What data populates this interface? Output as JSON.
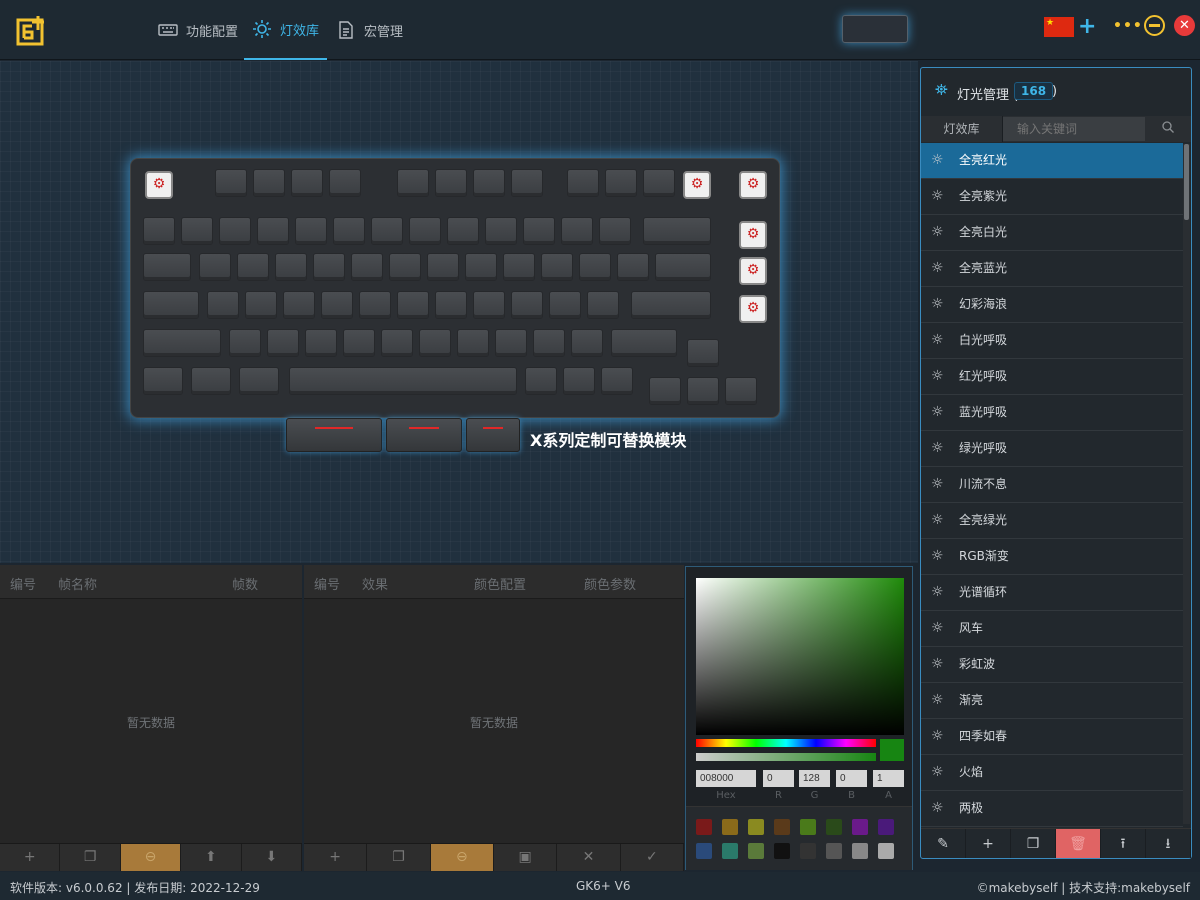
{
  "nav": {
    "tabs": [
      {
        "label": "功能配置"
      },
      {
        "label": "灯效库"
      },
      {
        "label": "宏管理"
      }
    ],
    "active": "灯效库"
  },
  "keyboard": {
    "spare_label": "X系列定制可替换模块"
  },
  "frames_panel": {
    "headers": [
      "编号",
      "帧名称",
      "帧数"
    ],
    "empty": "暂无数据"
  },
  "effects_panel": {
    "headers": [
      "编号",
      "效果",
      "颜色配置",
      "颜色参数"
    ],
    "empty": "暂无数据"
  },
  "color_picker": {
    "hex": "008000",
    "r": "0",
    "g": "128",
    "b": "0",
    "a": "1",
    "labels": [
      "Hex",
      "R",
      "G",
      "B",
      "A"
    ],
    "current_color": "#178512",
    "swatches": [
      "#7a1a1a",
      "#8a6a1a",
      "#8a8a20",
      "#5a3a1a",
      "#4a7a1a",
      "#2a4a1a",
      "#6a1a8a",
      "#4a1a7a",
      "#2a4a7a",
      "#2a7a6a",
      "#5a7a3a",
      "#111111",
      "#333333",
      "#555555",
      "#888888",
      "#aaaaaa"
    ]
  },
  "light_manager": {
    "title": "灯光管理 (",
    "count": "168",
    "title_end": ")",
    "tab": "灯效库",
    "search_placeholder": "输入关键词",
    "items": [
      "全亮红光",
      "全亮紫光",
      "全亮白光",
      "全亮蓝光",
      "幻彩海浪",
      "白光呼吸",
      "红光呼吸",
      "蓝光呼吸",
      "绿光呼吸",
      "川流不息",
      "全亮绿光",
      "RGB渐变",
      "光谱循环",
      "风车",
      "彩虹波",
      "渐亮",
      "四季如春",
      "火焰",
      "两极"
    ],
    "selected_index": 0
  },
  "status": {
    "left": "软件版本: v6.0.0.62 | 发布日期: 2022-12-29",
    "middle": "GK6+ V6",
    "right": "©makebyself | 技术支持:makebyself"
  },
  "accent_color": "#3fb6e8"
}
